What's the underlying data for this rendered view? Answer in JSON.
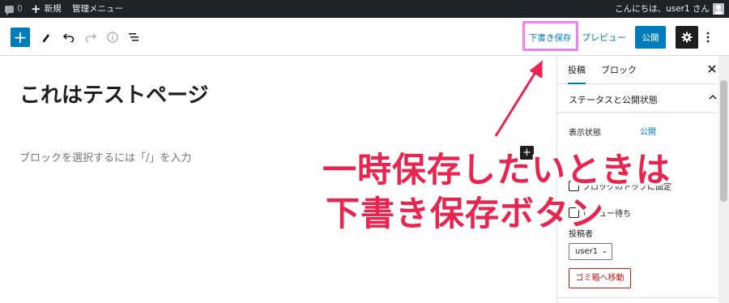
{
  "admin_bar": {
    "comment_count": "0",
    "new_label": "新規",
    "admin_menu_label": "管理メニュー",
    "greeting": "こんにちは、user1 さん"
  },
  "toolbar": {
    "draft_label": "下書き保存",
    "preview_label": "プレビュー",
    "publish_label": "公開"
  },
  "content": {
    "page_title": "これはテストページ",
    "block_placeholder": "ブロックを選択するには「/」を入力"
  },
  "sidebar": {
    "tab_post": "投稿",
    "tab_block": "ブロック",
    "panel_title": "ステータスと公開状態",
    "visibility_label": "表示状態",
    "visibility_value": "公開",
    "stick_to_top_label": "ブロックのトップに固定",
    "pending_review_label": "レビュー待ち",
    "author_label": "投稿者",
    "author_value": "user1",
    "trash_label": "ゴミ箱へ移動"
  },
  "annotation": {
    "line1": "一時保存したいときは",
    "line2": "下書き保存ボタン",
    "color": "#e8244f",
    "highlight_color": "#ee82ee"
  },
  "colors": {
    "accent": "#007cba",
    "admin_bar": "#1d2327"
  }
}
